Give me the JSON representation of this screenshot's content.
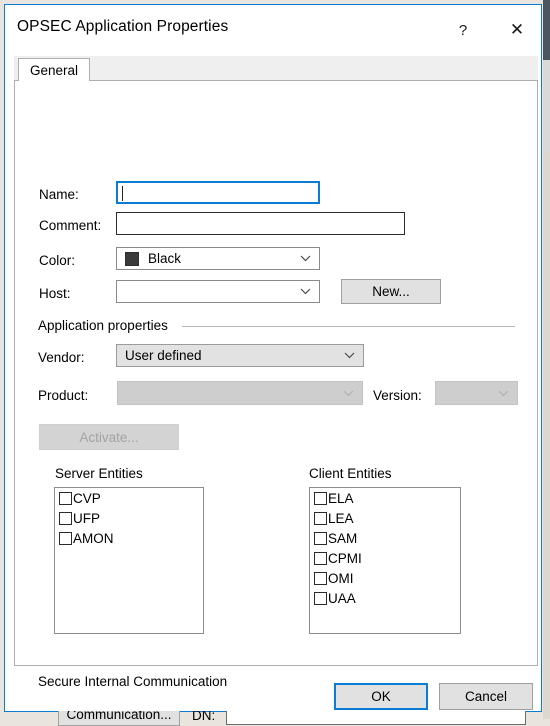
{
  "window": {
    "title": "OPSEC Application Properties",
    "help_label": "?",
    "close_label": "✕"
  },
  "tabs": [
    {
      "label": "General",
      "selected": true
    }
  ],
  "general": {
    "name": {
      "label": "Name:",
      "value": "",
      "focused": true
    },
    "comment": {
      "label": "Comment:",
      "value": ""
    },
    "color": {
      "label": "Color:",
      "value": "Black",
      "swatch_hex": "#3a3a3a"
    },
    "host": {
      "label": "Host:",
      "value": ""
    },
    "new_button": {
      "label": "New..."
    }
  },
  "application_properties": {
    "group_label": "Application properties",
    "vendor": {
      "label": "Vendor:",
      "value": "User defined"
    },
    "product": {
      "label": "Product:",
      "value": "",
      "enabled": false
    },
    "version": {
      "label": "Version:",
      "value": "",
      "enabled": false
    },
    "activate_button": {
      "label": "Activate...",
      "enabled": false
    }
  },
  "server_entities": {
    "title": "Server Entities",
    "items": [
      {
        "label": "CVP",
        "checked": false
      },
      {
        "label": "UFP",
        "checked": false
      },
      {
        "label": "AMON",
        "checked": false
      }
    ]
  },
  "client_entities": {
    "title": "Client Entities",
    "items": [
      {
        "label": "ELA",
        "checked": false
      },
      {
        "label": "LEA",
        "checked": false
      },
      {
        "label": "SAM",
        "checked": false
      },
      {
        "label": "CPMI",
        "checked": false
      },
      {
        "label": "OMI",
        "checked": false
      },
      {
        "label": "UAA",
        "checked": false
      }
    ]
  },
  "secure_internal_communication": {
    "group_label": "Secure Internal Communication",
    "communication_button": {
      "label": "Communication..."
    },
    "dn": {
      "label": "DN:",
      "value": ""
    }
  },
  "footer": {
    "ok_label": "OK",
    "cancel_label": "Cancel"
  },
  "theme": {
    "accent_hex": "#0a7cd4",
    "dialog_bg_hex": "#ffffff",
    "control_bg_hex": "#e1e1e1",
    "disabled_bg_hex": "#d3d3d3",
    "disabled_text_hex": "#a3a3a3"
  }
}
